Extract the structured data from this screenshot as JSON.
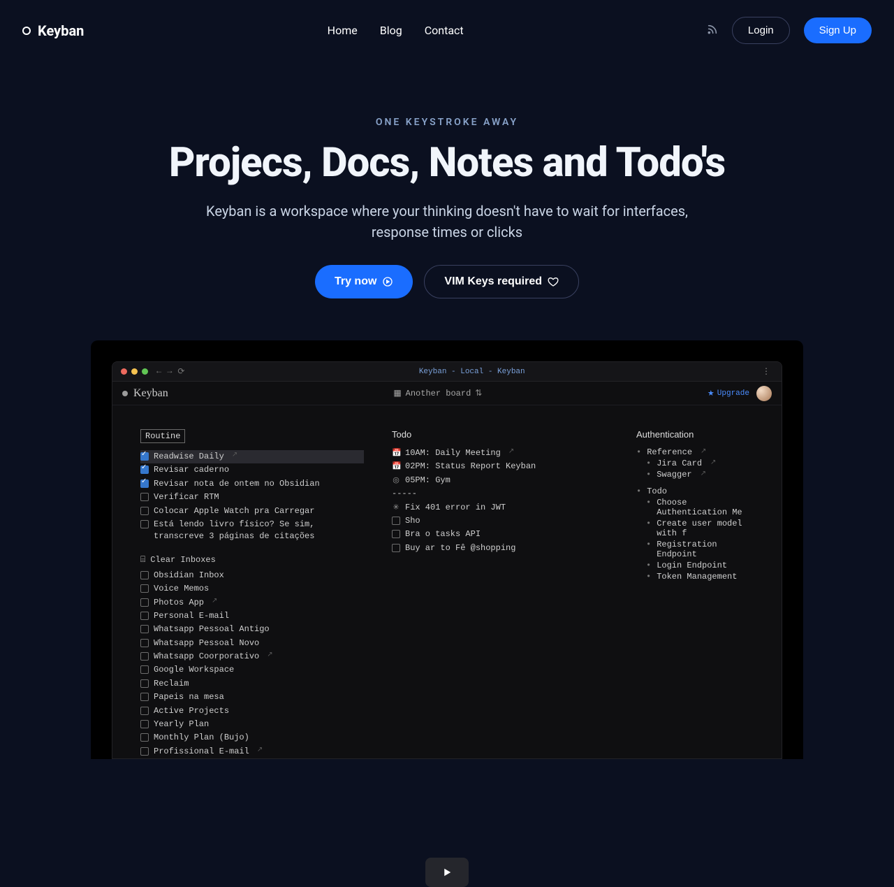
{
  "nav": {
    "brand": "Keyban",
    "links": [
      "Home",
      "Blog",
      "Contact"
    ],
    "login": "Login",
    "signup": "Sign Up"
  },
  "hero": {
    "kicker": "ONE KEYSTROKE AWAY",
    "headline": "Projecs, Docs, Notes and Todo's",
    "subhead": "Keyban is a workspace where your thinking doesn't have to wait for interfaces, response times or clicks",
    "cta_primary": "Try now",
    "cta_secondary": "VIM Keys required"
  },
  "video": {
    "address": "Keyban - Local - Keyban",
    "app_brand": "Keyban",
    "board_selector": "Another board",
    "upgrade": "Upgrade",
    "left": {
      "tag": "Routine",
      "items": [
        {
          "icon": "ck",
          "text": "Readwise Daily",
          "ext": true,
          "sel": true
        },
        {
          "icon": "ck",
          "text": "Revisar caderno"
        },
        {
          "icon": "ck",
          "text": "Revisar nota de ontem no Obsidian"
        },
        {
          "icon": "sq",
          "text": "Verificar RTM"
        },
        {
          "icon": "sq",
          "text": "Colocar Apple Watch pra Carregar"
        },
        {
          "icon": "sq",
          "text": "Está lendo livro físico? Se sim, transcreve 3 páginas de citações"
        }
      ],
      "section2_title": "Clear Inboxes",
      "items2": [
        {
          "icon": "sq",
          "text": "Obsidian Inbox"
        },
        {
          "icon": "sq",
          "text": "Voice Memos"
        },
        {
          "icon": "sq",
          "text": "Photos App",
          "ext": true
        },
        {
          "icon": "sq",
          "text": "Personal E-mail"
        },
        {
          "icon": "sq",
          "text": "Whatsapp Pessoal Antigo"
        },
        {
          "icon": "sq",
          "text": "Whatsapp Pessoal Novo"
        },
        {
          "icon": "sq",
          "text": "Whatsapp Coorporativo",
          "ext": true
        },
        {
          "icon": "sq",
          "text": "Google Workspace"
        },
        {
          "icon": "sq",
          "text": "Reclaim"
        },
        {
          "icon": "sq",
          "text": "Papeis na mesa"
        },
        {
          "icon": "sq",
          "text": "Active Projects"
        },
        {
          "icon": "sq",
          "text": "Yearly Plan"
        },
        {
          "icon": "sq",
          "text": "Monthly Plan (Bujo)"
        },
        {
          "icon": "sq",
          "text": "Profissional E-mail",
          "ext": true
        }
      ]
    },
    "mid": {
      "title": "Todo",
      "items": [
        {
          "icon": "📅",
          "text": "10AM: Daily Meeting",
          "ext": true
        },
        {
          "icon": "📅",
          "text": "02PM: Status Report Keyban"
        },
        {
          "icon": "◎",
          "text": "05PM: Gym"
        },
        {
          "icon": "",
          "text": "-----"
        },
        {
          "icon": "✳",
          "text": "Fix 401 error in JWT"
        },
        {
          "icon": "sq",
          "text": "Sho"
        },
        {
          "icon": "sq",
          "text": "Bra           o tasks API"
        },
        {
          "icon": "sq",
          "text": "Buy          ar to Fê @shopping"
        }
      ]
    },
    "right": {
      "title": "Authentication",
      "groups": [
        {
          "head": "Reference",
          "ext": true,
          "items": [
            {
              "text": "Jira Card",
              "ext": true
            },
            {
              "text": "Swagger",
              "ext": true
            }
          ]
        },
        {
          "head": "Todo",
          "items": [
            {
              "text": "Choose Authentication Me"
            },
            {
              "text": "Create user model with f"
            },
            {
              "text": "Registration Endpoint"
            },
            {
              "text": "Login Endpoint"
            },
            {
              "text": "Token Management"
            }
          ]
        }
      ]
    }
  }
}
